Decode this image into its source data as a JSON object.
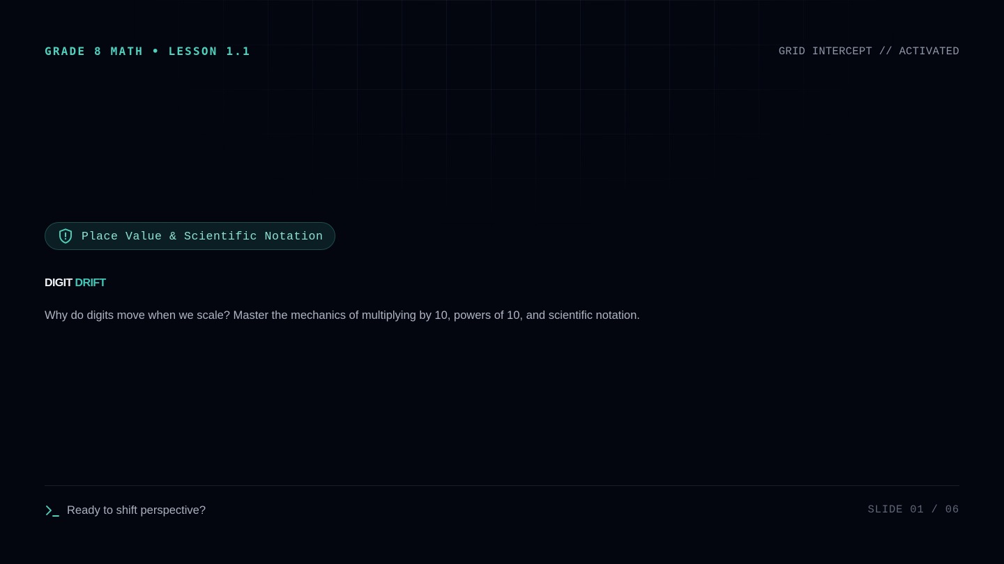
{
  "header": {
    "lesson_label": "GRADE 8 MATH • LESSON 1.1",
    "status_label": "GRID INTERCEPT // ACTIVATED"
  },
  "topic_pill": {
    "icon": "shield-alert-icon",
    "label": "Place Value & Scientific Notation"
  },
  "title": {
    "word1": "DIGIT",
    "word2": "DRIFT"
  },
  "subtitle": "Why do digits move when we scale? Master the mechanics of multiplying by 10, powers of 10, and scientific notation.",
  "footer": {
    "prompt_icon": "terminal-prompt-icon",
    "prompt_text": "Ready to shift perspective?",
    "slide_counter": "SLIDE 01 / 06"
  },
  "colors": {
    "background": "#03050f",
    "accent": "#4fd1bd",
    "title_white": "#f2f4f8",
    "muted_text": "#8e95a6"
  }
}
